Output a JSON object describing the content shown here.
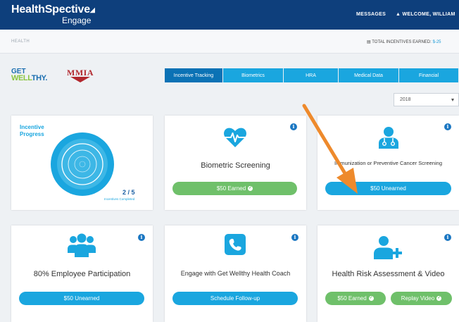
{
  "header": {
    "brand_main": "HealthSpective",
    "brand_sub": "Engage",
    "messages_label": "MESSAGES",
    "welcome_label": "WELCOME, WILLIAM"
  },
  "subbar": {
    "breadcrumb": "HEALTH",
    "total_label": "TOTAL INCENTIVES EARNED:",
    "total_amount": "$-25"
  },
  "logos": {
    "get_line1": "GET",
    "get_line2a": "WELL",
    "get_line2b": "THY.",
    "mmia": "MMIA"
  },
  "tabs": [
    {
      "label": "Incentive Tracking",
      "active": true
    },
    {
      "label": "Biometrics",
      "active": false
    },
    {
      "label": "HRA",
      "active": false
    },
    {
      "label": "Medical Data",
      "active": false
    },
    {
      "label": "Financial",
      "active": false
    }
  ],
  "year_select": {
    "value": "2018"
  },
  "progress": {
    "label_line1": "Incentive",
    "label_line2": "Progress",
    "count": "2 / 5",
    "sub": "Incentives Completed",
    "completed": 2,
    "total": 5
  },
  "cards": {
    "biometric": {
      "title": "Biometric Screening",
      "button": "$50 Earned"
    },
    "immunization": {
      "title": "Immunization or Preventive Cancer Screening",
      "button": "$50 Unearned"
    },
    "participation": {
      "title": "80% Employee Participation",
      "button": "$50 Unearned"
    },
    "coach": {
      "title": "Engage with Get Wellthy Health Coach",
      "button": "Schedule Follow-up"
    },
    "hra": {
      "title": "Health Risk Assessment & Video",
      "button_earned": "$50 Earned",
      "button_replay": "Replay Video"
    }
  },
  "icons": {
    "info": "info-icon",
    "heart": "heart-pulse-icon",
    "doctor": "doctor-icon",
    "group": "group-icon",
    "phone": "phone-icon",
    "user_add": "user-add-icon"
  },
  "colors": {
    "header_bg": "#0e3f7c",
    "accent_blue": "#1aa6df",
    "active_tab": "#0b72b5",
    "green": "#6fc06a",
    "annotation_arrow": "#ee8a2c"
  }
}
